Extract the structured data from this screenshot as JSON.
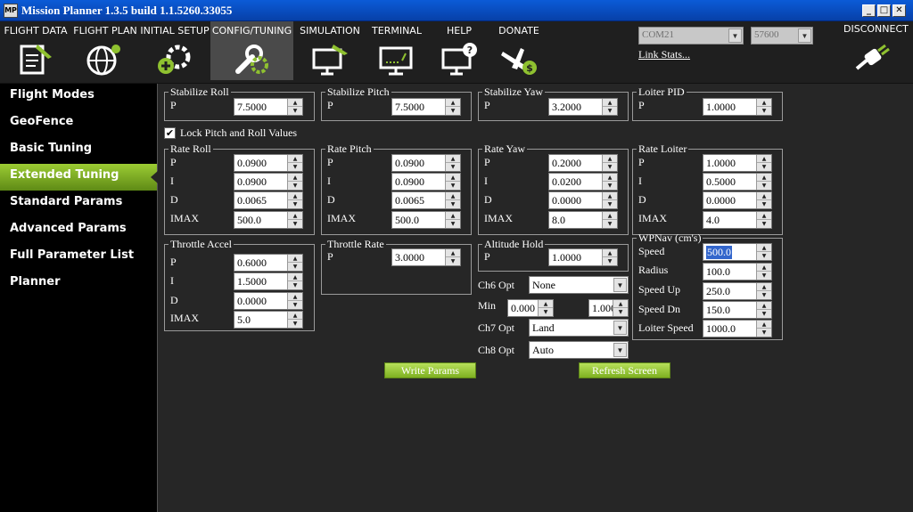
{
  "window": {
    "title": "Mission Planner 1.3.5 build 1.1.5260.33055",
    "icon_text": "MP",
    "controls": [
      "_",
      "□",
      "✕"
    ]
  },
  "menu": {
    "items": [
      {
        "label": "FLIGHT DATA",
        "icon": "clipboard-icon"
      },
      {
        "label": "FLIGHT PLAN",
        "icon": "globe-icon"
      },
      {
        "label": "INITIAL SETUP",
        "icon": "gear-plus-icon"
      },
      {
        "label": "CONFIG/TUNING",
        "icon": "wrench-gear-icon"
      },
      {
        "label": "SIMULATION",
        "icon": "monitor-plane-icon"
      },
      {
        "label": "TERMINAL",
        "icon": "terminal-icon"
      },
      {
        "label": "HELP",
        "icon": "monitor-question-icon"
      },
      {
        "label": "DONATE",
        "icon": "plane-dollar-icon"
      }
    ],
    "active": "CONFIG/TUNING",
    "port": "COM21",
    "baud": "57600",
    "link_stats": "Link Stats...",
    "disconnect": "DISCONNECT"
  },
  "sidebar": {
    "items": [
      {
        "label": "Flight Modes"
      },
      {
        "label": "GeoFence"
      },
      {
        "label": "Basic Tuning"
      },
      {
        "label": "Extended Tuning"
      },
      {
        "label": "Standard Params"
      },
      {
        "label": "Advanced Params"
      },
      {
        "label": "Full Parameter List"
      },
      {
        "label": "Planner"
      }
    ],
    "active": "Extended Tuning"
  },
  "tuning": {
    "stabilize_roll": {
      "title": "Stabilize Roll",
      "p_label": "P",
      "p": "7.5000"
    },
    "stabilize_pitch": {
      "title": "Stabilize Pitch",
      "p_label": "P",
      "p": "7.5000"
    },
    "stabilize_yaw": {
      "title": "Stabilize Yaw",
      "p_label": "P",
      "p": "3.2000"
    },
    "loiter_pid": {
      "title": "Loiter PID",
      "p_label": "P",
      "p": "1.0000"
    },
    "lock_pitch_roll": {
      "label": "Lock Pitch and Roll Values",
      "checked": true,
      "mark": "✔"
    },
    "rate_roll": {
      "title": "Rate Roll",
      "labels": [
        "P",
        "I",
        "D",
        "IMAX"
      ],
      "values": [
        "0.0900",
        "0.0900",
        "0.0065",
        "500.0"
      ]
    },
    "rate_pitch": {
      "title": "Rate Pitch",
      "labels": [
        "P",
        "I",
        "D",
        "IMAX"
      ],
      "values": [
        "0.0900",
        "0.0900",
        "0.0065",
        "500.0"
      ]
    },
    "rate_yaw": {
      "title": "Rate Yaw",
      "labels": [
        "P",
        "I",
        "D",
        "IMAX"
      ],
      "values": [
        "0.2000",
        "0.0200",
        "0.0000",
        "8.0"
      ]
    },
    "rate_loiter": {
      "title": "Rate Loiter",
      "labels": [
        "P",
        "I",
        "D",
        "IMAX"
      ],
      "values": [
        "1.0000",
        "0.5000",
        "0.0000",
        "4.0"
      ]
    },
    "throttle_accel": {
      "title": "Throttle Accel",
      "labels": [
        "P",
        "I",
        "D",
        "IMAX"
      ],
      "values": [
        "0.6000",
        "1.5000",
        "0.0000",
        "5.0"
      ]
    },
    "throttle_rate": {
      "title": "Throttle Rate",
      "p_label": "P",
      "p": "3.0000"
    },
    "altitude_hold": {
      "title": "Altitude Hold",
      "p_label": "P",
      "p": "1.0000"
    },
    "wpnav": {
      "title": "WPNav (cm's)",
      "labels": [
        "Speed",
        "Radius",
        "Speed Up",
        "Speed Dn",
        "Loiter Speed"
      ],
      "values": [
        "500.0",
        "100.0",
        "250.0",
        "150.0",
        "1000.0"
      ]
    },
    "ch6_opt": {
      "label": "Ch6 Opt",
      "value": "None"
    },
    "min": {
      "label": "Min",
      "min": "0.000",
      "max": "1.000"
    },
    "ch7_opt": {
      "label": "Ch7 Opt",
      "value": "Land"
    },
    "ch8_opt": {
      "label": "Ch8 Opt",
      "value": "Auto"
    }
  },
  "buttons": {
    "write": "Write Params",
    "refresh": "Refresh Screen"
  },
  "colors": {
    "accent": "#8fc130",
    "title_bar": "#0b5bd7",
    "background": "#262626"
  }
}
